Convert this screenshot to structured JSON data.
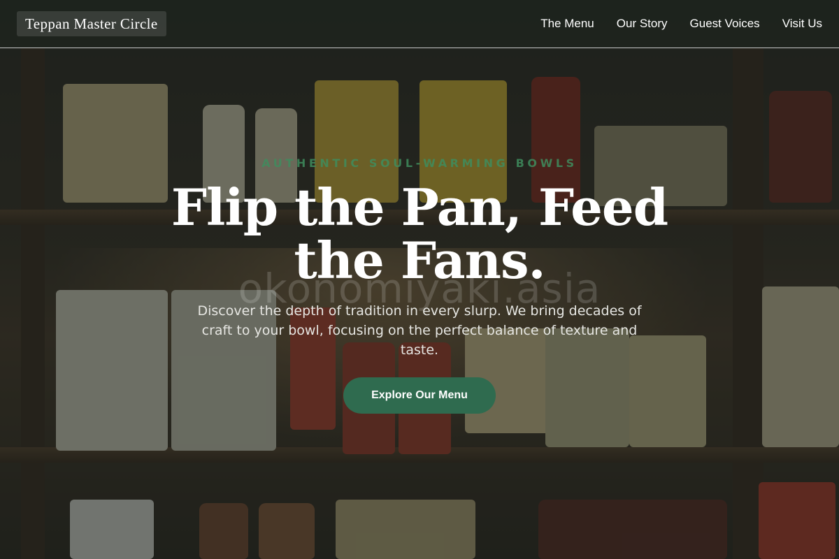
{
  "header": {
    "brand": "Teppan Master Circle",
    "nav": [
      "The Menu",
      "Our Story",
      "Guest Voices",
      "Visit Us"
    ]
  },
  "hero": {
    "eyebrow": "AUTHENTIC SOUL-WARMING BOWLS",
    "headline": "Flip the Pan, Feed the Fans.",
    "watermark": "okonomiyaki.asia",
    "lead": "Discover the depth of tradition in every slurp. We bring decades of craft to your bowl, focusing on the perfect balance of texture and taste.",
    "cta": "Explore Our Menu"
  },
  "colors": {
    "accent": "#2f6b4f",
    "eyebrow": "#3f8d5e",
    "text": "#ffffff"
  }
}
